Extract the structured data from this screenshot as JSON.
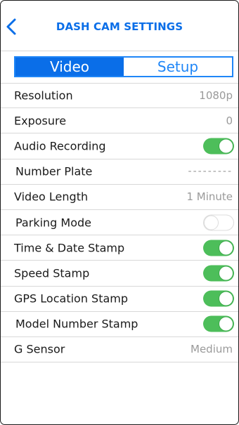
{
  "header": {
    "title": "DASH CAM SETTINGS",
    "back_icon": "chevron-left-icon"
  },
  "tabs": [
    {
      "label": "Video",
      "active": true
    },
    {
      "label": "Setup",
      "active": false
    }
  ],
  "colors": {
    "accent": "#0a6ee8",
    "toggle_on": "#4dbe5a"
  },
  "settings": [
    {
      "label": "Resolution",
      "value": "1080p"
    },
    {
      "label": "Exposure",
      "value": "0"
    },
    {
      "label": "Audio Recording",
      "toggle": true
    },
    {
      "label": "Number Plate",
      "placeholder": "---------"
    },
    {
      "label": "Video Length",
      "value": "1 Minute"
    },
    {
      "label": "Parking Mode",
      "toggle": false
    },
    {
      "label": "Time & Date Stamp",
      "toggle": true
    },
    {
      "label": "Speed Stamp",
      "toggle": true
    },
    {
      "label": "GPS Location Stamp",
      "toggle": true
    },
    {
      "label": "Model Number Stamp",
      "toggle": true
    },
    {
      "label": "G Sensor",
      "value": "Medium"
    }
  ]
}
